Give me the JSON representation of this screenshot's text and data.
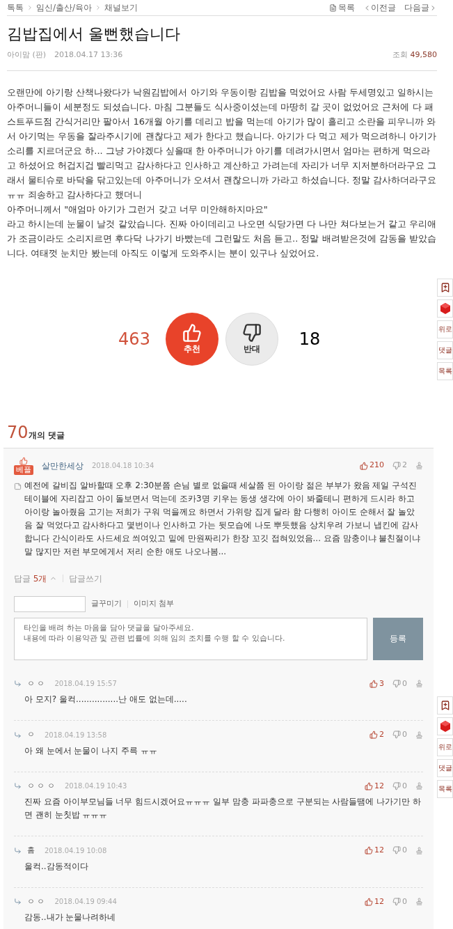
{
  "breadcrumb": [
    "톡톡",
    "임신/출산/육아",
    "채널보기"
  ],
  "nav": {
    "list": "목록",
    "prev": "이전글",
    "next": "다음글"
  },
  "post": {
    "title": "김밥집에서 울뻔했습니다",
    "author": "아이맘 (판)",
    "date": "2018.04.17 13:36",
    "views_label": "조회",
    "views": "49,580",
    "paragraphs": [
      "오랜만에 아기랑 산책나왔다가 낙원김밥에서 아기와 우동이랑 김밥을 먹었어요 사람 두세명있고 일하시는 아주머니들이 세분정도 되셨습니다. 마침 그분들도 식사중이셨는데 마땅히 갈 곳이 없었어요 근처에 다 패스트푸드점 간식거리만 팔아서 16개월 아기를 데리고 밥을 먹는데 아기가 많이 흘리고 소란을 피우니까 와서 아기먹는 우동을 잘라주시기에 괜찮다고 제가 한다고 했습니다. 아기가 다 먹고 제가 먹으려하니 아기가 소리를 지르더군요 하... 그냥 가야겠다 싶을때 한 아주머니가 아기를 데려가시면서 엄마는 편하게 먹으라고 하셨어요 허겁지겁 빨리먹고 감사하다고 인사하고 계산하고 가려는데 자리가 너무 지저분하더라구요 그래서 물티슈로 바닥을 닦고있는데 아주머니가 오셔서 괜찮으니까 가라고 하셨습니다. 정말 감사하더라구요ㅠㅠ 죄송하고 감사하다고 했더니",
      "아주머니께서 \"애엄마 아기가 그런거 갖고 너무 미안해하지마요\"",
      "라고 하시는데 눈물이 날것 같았습니다. 진짜 아이데리고 나오면 식당가면 다 나만 쳐다보는거 같고 우리애가 조금이라도 소리지르면 후다닥 나가기 바빴는데 그런말도 처음 듣고.. 정말 배려받은것에 감동을 받았습니다. 여태껏 눈치만 봤는데 아직도 이렇게 도와주시는 분이 있구나 싶었어요."
    ]
  },
  "votes": {
    "up_count": "463",
    "up_label": "추천",
    "down_label": "반대",
    "down_count": "18"
  },
  "comments_header": {
    "count": "70",
    "label": "개의 댓글"
  },
  "best_comment": {
    "badge": "베플",
    "author": "살만한세상",
    "date": "2018.04.18 10:34",
    "likes": "210",
    "dislikes": "2",
    "text": "예전에 갈비집 알바할때 오후 2:30분쯤 손님 별로 없을때 세살쯤 된 아이랑 젊은 부부가 왔음 제일 구석진 테이블에 자리잡고 아이 돌보면서 먹는데 조카3명 키우는 동생 생각에 아이 봐줄테니 편하게 드시라 하고 아이랑 놀아줬음 고기는 저희가 구워 먹을께요 하면서 가위랑 집게 달라 함 다행히 아이도 순해서 잘 놀았음 잘 먹었다고 감사하다고 몇번이나 인사하고 가는 뒷모습에 나도 뿌듯했음 상치우려 가보니 냅킨에 감사합니다 간식이라도 사드세요 씌여있고 밑에 만원짜리가 한장 꼬깃 접혀있었음... 요즘 맘충이냐 불친절이냐 말 많지만 저런 부모에게서 저리 순한 애도 나오나봄...",
    "reply_label": "답글",
    "reply_count": "5개",
    "expanded": true,
    "write_reply": "답글쓰기"
  },
  "editor": {
    "tools": [
      "글꾸미기",
      "이미지 첨부"
    ],
    "placeholder": "타인을 배려 하는 마음을 담아 댓글을 달아주세요.\n내용에 따라 이용약관 및 관련 법률에 의해 임의 조치를 수행 할 수 있습니다.",
    "submit": "등록"
  },
  "replies": [
    {
      "author": "ㅇ ㅇ",
      "date": "2018.04.19 15:57",
      "likes": "3",
      "dislikes": "0",
      "text": "아 모지? 울컥................난 애도 없는데....."
    },
    {
      "author": "ㅇ",
      "date": "2018.04.19 13:58",
      "likes": "2",
      "dislikes": "0",
      "text": "아 왜 눈에서 눈물이 나지 주륵 ㅠㅠ"
    },
    {
      "author": "ㅇ ㅇ ㅇ",
      "date": "2018.04.19 10:43",
      "likes": "12",
      "dislikes": "0",
      "text": "진짜 요즘 아이부모님들 너무 힘드시겠어요ㅠㅠㅠ 일부 맘충 파파충으로 구분되는 사람들땜에 나가기만 하면 괜히 눈칫밥 ㅠㅠㅠ"
    },
    {
      "author": "흠",
      "date": "2018.04.19 10:08",
      "likes": "12",
      "dislikes": "0",
      "text": "울컥..감동적이다"
    },
    {
      "author": "ㅇ ㅇ",
      "date": "2018.04.19 09:44",
      "likes": "12",
      "dislikes": "0",
      "text": "감동..내가 눈물나려하네"
    }
  ],
  "side_toolbars": [
    {
      "labels": [
        "위로",
        "댓글",
        "목록"
      ]
    },
    {
      "labels": [
        "위로",
        "댓글",
        "목록"
      ]
    }
  ]
}
